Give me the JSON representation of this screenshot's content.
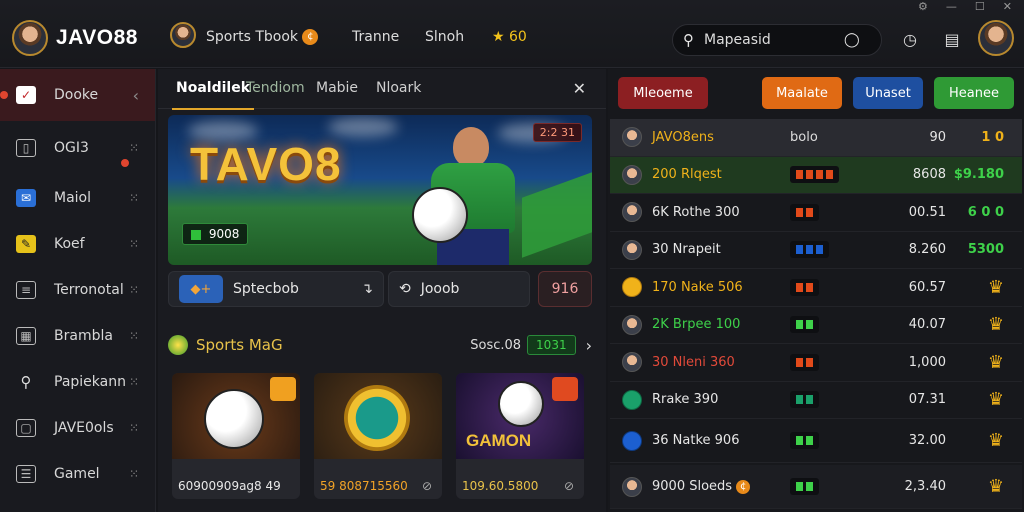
{
  "brand": {
    "name": "JAVO88"
  },
  "topnav": {
    "sportsbook": "Sports Tbook",
    "item2": "Tranne",
    "item3": "Slnoh",
    "points": "60"
  },
  "search": {
    "value": "Mapeasid"
  },
  "sidebar": {
    "items": [
      {
        "label": "Dooke"
      },
      {
        "label": "OGI3"
      },
      {
        "label": "Maiol"
      },
      {
        "label": "Koef"
      },
      {
        "label": "Terronotal"
      },
      {
        "label": "Brambla"
      },
      {
        "label": "Papiekann"
      },
      {
        "label": "JAVE0ols"
      },
      {
        "label": "Gamel"
      }
    ]
  },
  "center": {
    "tabs": [
      "Noaldilek",
      "Tendiom",
      "Mabie",
      "Nloark"
    ],
    "hero": {
      "title": "TAVO8",
      "badge": "2:2 31",
      "score": "9008"
    },
    "actions": {
      "left": "Sptecbob",
      "right": "Jooob",
      "count": "916"
    },
    "games": {
      "title": "Sports MaG",
      "count": "Sosc.08",
      "badge": "1031",
      "cards": [
        {
          "caption": "60900909ag8 49",
          "color": "#e8e8e8"
        },
        {
          "caption": "59 808715560",
          "color": "#f1a227"
        },
        {
          "caption": "109.60.5800",
          "color": "#e8c24a",
          "art_text": "GAMON"
        }
      ]
    }
  },
  "right": {
    "buttons": [
      {
        "label": "Mleoeme",
        "color": "#8c1f22"
      },
      {
        "label": "Maalate",
        "color": "#e06a14"
      },
      {
        "label": "Unaset",
        "color": "#1e4fa0"
      },
      {
        "label": "Heanee",
        "color": "#2f9a35"
      }
    ],
    "rows": [
      {
        "name": "JAVO8ens",
        "name_color": "#f0b21a",
        "bars": "bolo",
        "value": "90",
        "stat": "1 0",
        "stat_color": "#f0b21a"
      },
      {
        "name": "200 Rlqest",
        "name_color": "#f0b21a",
        "bars_color": "#e24a1a",
        "value": "8608",
        "stat": "$9.180",
        "stat_color": "#3ed14a"
      },
      {
        "name": "6K Rothe 300",
        "name_color": "#e6e6e6",
        "bars_color": "#e24a1a",
        "value": "00.51",
        "stat": "6 0 0",
        "stat_color": "#3ed14a"
      },
      {
        "name": "30 Nrapeit",
        "name_color": "#e6e6e6",
        "bars_color": "#1c5fd0",
        "value": "8.260",
        "stat": "5300",
        "stat_color": "#3ed14a"
      },
      {
        "name": "170 Nake 506",
        "name_color": "#f0b21a",
        "bars_color": "#e24a1a",
        "value": "60.57",
        "stat": "trophy",
        "stat_color": "#f0b21a"
      },
      {
        "name": "2K Brpee 100",
        "name_color": "#3ed14a",
        "bars_color": "#3ed14a",
        "value": "40.07",
        "stat": "trophy",
        "stat_color": "#f0b21a"
      },
      {
        "name": "30 Nleni 360",
        "name_color": "#e24a3a",
        "bars_color": "#e24a1a",
        "value": "1,000",
        "stat": "trophy",
        "stat_color": "#f0b21a"
      },
      {
        "name": "Rrake 390",
        "name_color": "#e6e6e6",
        "bars_color": "#1aa06a",
        "value": "07.31",
        "stat": "trophy",
        "stat_color": "#f0b21a"
      },
      {
        "name": "36 Natke 906",
        "name_color": "#e6e6e6",
        "bars_color": "#3ed14a",
        "value": "32.00",
        "stat": "trophy",
        "stat_color": "#f0b21a"
      },
      {
        "name": "9000 Sloeds",
        "name_color": "#e6e6e6",
        "bars_color": "#3ed14a",
        "value": "2,3.40",
        "stat": "trophy",
        "stat_color": "#f0b21a"
      }
    ]
  }
}
